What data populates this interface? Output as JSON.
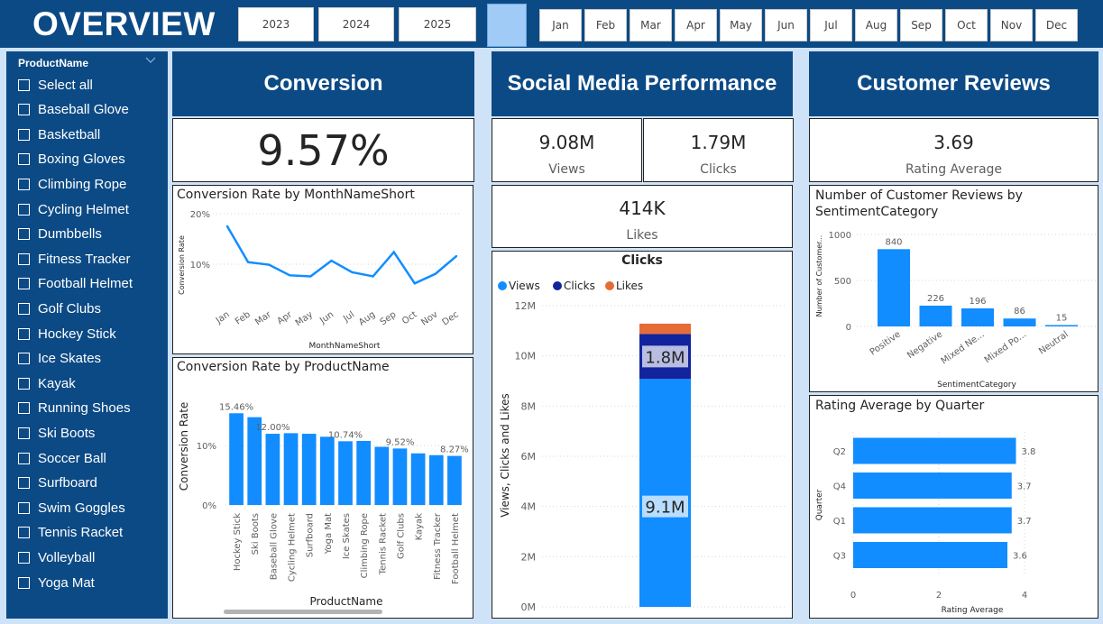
{
  "app_title": "OVERVIEW",
  "years": [
    "2023",
    "2024",
    "2025"
  ],
  "months": [
    "Jan",
    "Feb",
    "Mar",
    "Apr",
    "May",
    "Jun",
    "Jul",
    "Aug",
    "Sep",
    "Oct",
    "Nov",
    "Dec"
  ],
  "colors": {
    "navy": "#0c4a85",
    "bar": "#118dff",
    "dark_blue": "#12239e",
    "orange": "#e66c37",
    "page_bg": "#cfe3f8"
  },
  "slicer": {
    "title": "ProductName",
    "items": [
      "Select all",
      "Baseball Glove",
      "Basketball",
      "Boxing Gloves",
      "Climbing Rope",
      "Cycling Helmet",
      "Dumbbells",
      "Fitness Tracker",
      "Football Helmet",
      "Golf Clubs",
      "Hockey Stick",
      "Ice Skates",
      "Kayak",
      "Running Shoes",
      "Ski Boots",
      "Soccer Ball",
      "Surfboard",
      "Swim Goggles",
      "Tennis Racket",
      "Volleyball",
      "Yoga Mat"
    ]
  },
  "sections": {
    "conversion": "Conversion",
    "social": "Social Media Performance",
    "reviews": "Customer Reviews"
  },
  "kpis": {
    "conversion_value": "9.57%",
    "views_value": "9.08M",
    "views_label": "Views",
    "clicks_value": "1.79M",
    "clicks_label": "Clicks",
    "likes_value": "414K",
    "likes_label": "Likes",
    "rating_value": "3.69",
    "rating_label": "Rating Average"
  },
  "chart_data": [
    {
      "id": "conv-month",
      "type": "line",
      "title": "Conversion Rate by MonthNameShort",
      "xlabel": "MonthNameShort",
      "ylabel": "Conversion Rate",
      "categories": [
        "Jan",
        "Feb",
        "Mar",
        "Apr",
        "May",
        "Jun",
        "Jul",
        "Aug",
        "Sep",
        "Oct",
        "Nov",
        "Dec"
      ],
      "values": [
        17.5,
        10.4,
        9.9,
        7.8,
        7.6,
        10.7,
        8.4,
        7.6,
        12.4,
        6.2,
        8.1,
        11.6
      ],
      "yticks": [
        "10%",
        "20%"
      ],
      "ylim": [
        5,
        20
      ],
      "grid": true
    },
    {
      "id": "conv-product",
      "type": "bar",
      "title": "Conversion Rate by ProductName",
      "xlabel": "ProductName",
      "ylabel": "Conversion Rate",
      "categories": [
        "Hockey Stick",
        "Ski Boots",
        "Baseball Glove",
        "Cycling Helmet",
        "Surfboard",
        "Yoga Mat",
        "Ice Skates",
        "Climbing Rope",
        "Tennis Racket",
        "Golf Clubs",
        "Kayak",
        "Fitness Tracker",
        "Football Helmet"
      ],
      "values": [
        15.46,
        14.8,
        12.0,
        12.1,
        12.0,
        11.5,
        10.74,
        10.8,
        9.8,
        9.52,
        8.7,
        8.4,
        8.27
      ],
      "data_labels": [
        "15.46%",
        "",
        "12.00%",
        "",
        "",
        "",
        "10.74%",
        "",
        "",
        "9.52%",
        "",
        "",
        "8.27%"
      ],
      "yticks": [
        "0%",
        "10%"
      ],
      "ylim": [
        0,
        19
      ],
      "grid": true
    },
    {
      "id": "social-stack",
      "type": "bar",
      "title": "Clicks",
      "ylabel": "Views, Clicks and Likes",
      "categories": [
        ""
      ],
      "series": [
        {
          "name": "Views",
          "values": [
            9.08
          ]
        },
        {
          "name": "Clicks",
          "values": [
            1.79
          ]
        },
        {
          "name": "Likes",
          "values": [
            0.414
          ]
        }
      ],
      "segment_labels": [
        "9.1M",
        "1.8M",
        ""
      ],
      "yticks": [
        "0M",
        "2M",
        "4M",
        "6M",
        "8M",
        "10M",
        "12M"
      ],
      "ylim": [
        0,
        12
      ],
      "legend": "top-left",
      "grid": true
    },
    {
      "id": "sentiment",
      "type": "bar",
      "title": "Number of Customer Reviews by SentimentCategory",
      "xlabel": "SentimentCategory",
      "ylabel": "Number of Customer...",
      "categories": [
        "Positive",
        "Negative",
        "Mixed Ne...",
        "Mixed Po...",
        "Neutral"
      ],
      "values": [
        840,
        226,
        196,
        86,
        15
      ],
      "data_labels": [
        "840",
        "226",
        "196",
        "86",
        "15"
      ],
      "yticks": [
        "0",
        "500",
        "1000"
      ],
      "ylim": [
        0,
        1000
      ],
      "grid": true
    },
    {
      "id": "rating-quarter",
      "type": "bar",
      "orientation": "horizontal",
      "title": "Rating Average by Quarter",
      "xlabel": "Rating Average",
      "ylabel": "Quarter",
      "categories": [
        "Q2",
        "Q4",
        "Q1",
        "Q3"
      ],
      "values": [
        3.8,
        3.7,
        3.7,
        3.6
      ],
      "data_labels": [
        "3.8",
        "3.7",
        "3.7",
        "3.6"
      ],
      "xticks": [
        "0",
        "2",
        "4"
      ],
      "xlim": [
        0,
        4
      ],
      "grid": true
    }
  ]
}
